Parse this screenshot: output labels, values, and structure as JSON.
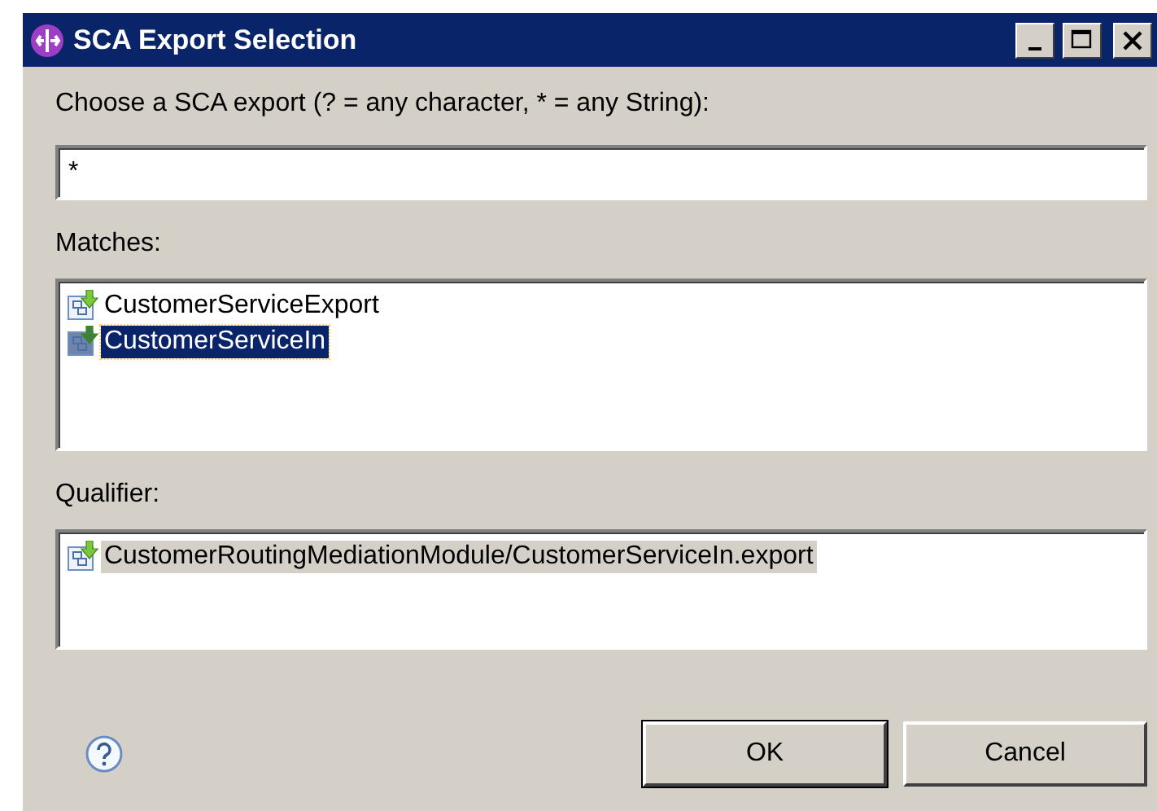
{
  "window": {
    "title": "SCA Export Selection"
  },
  "prompt": "Choose a SCA export (? = any character, * = any String):",
  "filter": {
    "value": "*"
  },
  "matches": {
    "label": "Matches:",
    "items": [
      {
        "text": "CustomerServiceExport",
        "selected": false
      },
      {
        "text": "CustomerServiceIn",
        "selected": true
      }
    ]
  },
  "qualifier": {
    "label": "Qualifier:",
    "items": [
      {
        "text": "CustomerRoutingMediationModule/CustomerServiceIn.export",
        "selected": true
      }
    ]
  },
  "buttons": [
    "OK",
    "Cancel"
  ]
}
